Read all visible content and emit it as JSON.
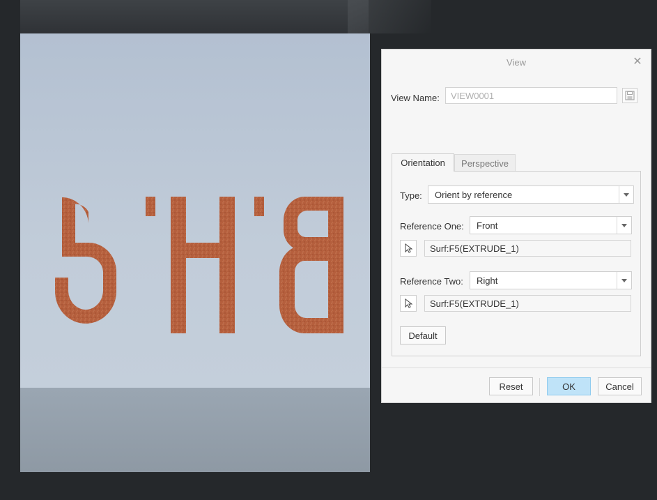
{
  "viewport": {
    "model_text": "SHB",
    "colors": {
      "background": "#25282b",
      "viewport_top": "#b3c0d1",
      "viewport_floor": "#9aa6b2",
      "model": "#b55f3d"
    }
  },
  "dialog": {
    "title": "View",
    "close_icon": "close-icon",
    "view_name_label": "View Name:",
    "view_name_value": "VIEW0001",
    "save_icon": "save-icon",
    "tabs": [
      {
        "label": "Orientation",
        "active": true
      },
      {
        "label": "Perspective",
        "active": false
      }
    ],
    "type_label": "Type:",
    "type_value": "Orient by reference",
    "reference_one_label": "Reference One:",
    "reference_one_value": "Front",
    "reference_one_surface": "Surf:F5(EXTRUDE_1)",
    "reference_two_label": "Reference Two:",
    "reference_two_value": "Right",
    "reference_two_surface": "Surf:F5(EXTRUDE_1)",
    "default_button": "Default",
    "reset_button": "Reset",
    "ok_button": "OK",
    "cancel_button": "Cancel",
    "accent_color": "#bfe3f8"
  }
}
